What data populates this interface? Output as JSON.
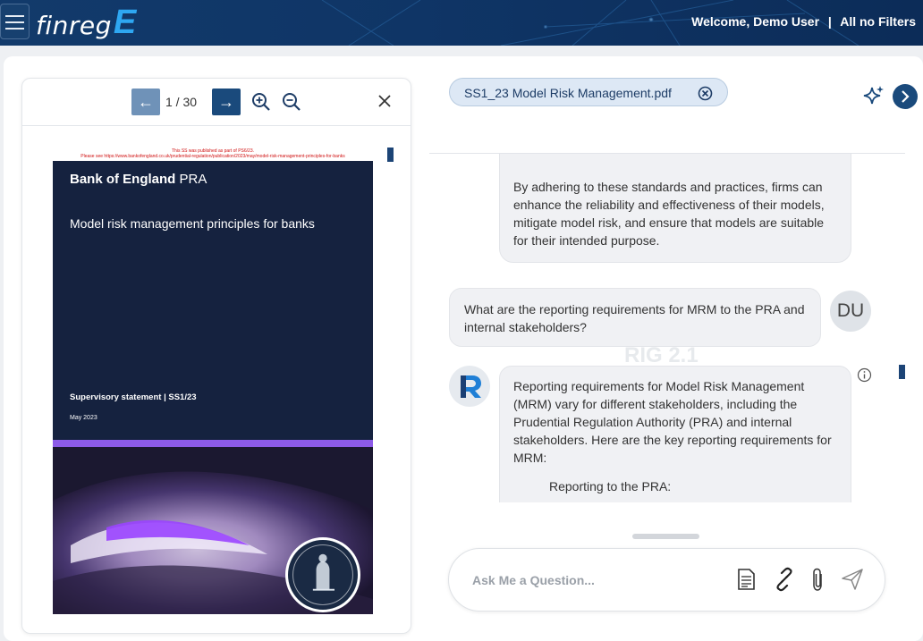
{
  "header": {
    "logo_text": "finreg",
    "logo_letter": "E",
    "welcome": "Welcome, Demo User",
    "separator": "|",
    "filters": "All no Filters"
  },
  "viewer": {
    "prev_icon": "←",
    "next_icon": "→",
    "page_indicator": "1 / 30",
    "document": {
      "notice_line1": "This SS was published as part of PS6/23.",
      "notice_line2": "Please see https://www.bankofengland.co.uk/prudential-regulation/publication/2023/may/model-risk-management-principles-for-banks",
      "brand_bold": "Bank of England",
      "brand_suffix": "PRA",
      "title": "Model risk management principles for banks",
      "statement": "Supervisory statement | SS1/23",
      "date": "May 2023"
    }
  },
  "chat": {
    "file_chip": "SS1_23 Model Risk Management.pdf",
    "messages": [
      {
        "role": "assistant",
        "text": "By adhering to these standards and practices, firms can enhance the reliability and effectiveness of their models, mitigate model risk, and ensure that models are suitable for their intended purpose."
      },
      {
        "role": "user",
        "text": "What are the reporting requirements for MRM to the PRA and internal stakeholders?",
        "avatar": "DU"
      },
      {
        "role": "assistant",
        "text": "Reporting requirements for Model Risk Management (MRM) vary for different stakeholders, including the Prudential Regulation Authority (PRA) and internal stakeholders. Here are the key reporting requirements for MRM:",
        "subheading": "Reporting to the PRA:"
      }
    ],
    "watermark": "RIG 2.1",
    "input_placeholder": "Ask Me a Question..."
  },
  "icons": {
    "menu": "hamburger-icon",
    "zoom_in": "zoom-in-icon",
    "zoom_out": "zoom-out-icon",
    "close": "close-icon",
    "remove_file": "remove-circle-icon",
    "ai": "sparkle-icon",
    "collapse": "chevron-right-icon",
    "info": "info-icon",
    "document": "document-icon",
    "link": "link-icon",
    "attach": "paperclip-icon",
    "send": "send-icon"
  },
  "colors": {
    "header_bg": "#0f3566",
    "accent_blue": "#1a4a7c",
    "logo_accent": "#2ea7f2",
    "chip_bg": "#dde8f5",
    "bubble_bg": "#f0f1f4",
    "cover_bg": "#15223f",
    "cover_stripe": "#8d5be8"
  }
}
